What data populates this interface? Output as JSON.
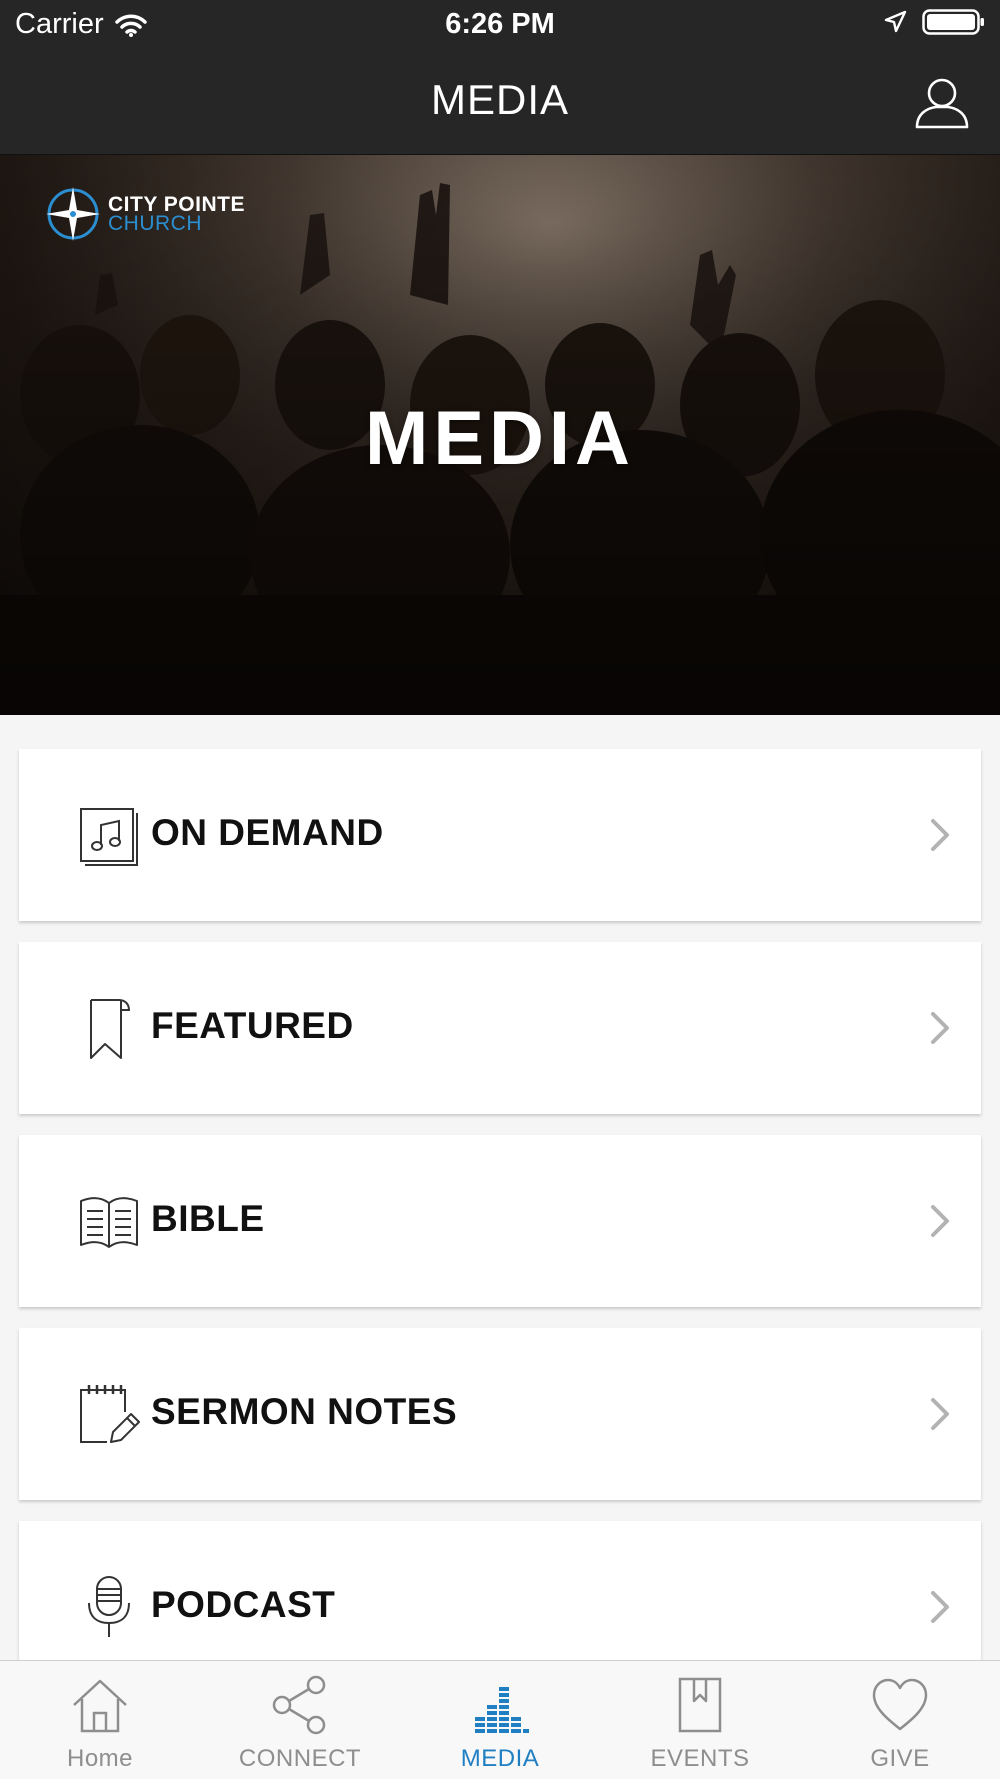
{
  "status_bar": {
    "carrier": "Carrier",
    "time": "6:26 PM"
  },
  "nav": {
    "title": "MEDIA"
  },
  "hero": {
    "logo_line1": "CITY POINTE",
    "logo_line2": "CHURCH",
    "title": "MEDIA"
  },
  "menu": {
    "items": [
      {
        "label": "ON DEMAND",
        "icon": "music-library-icon"
      },
      {
        "label": "FEATURED",
        "icon": "bookmark-icon"
      },
      {
        "label": "BIBLE",
        "icon": "open-book-icon"
      },
      {
        "label": "SERMON NOTES",
        "icon": "notepad-pencil-icon"
      },
      {
        "label": "PODCAST",
        "icon": "microphone-icon"
      }
    ]
  },
  "tabs": {
    "items": [
      {
        "label": "Home",
        "icon": "house-icon",
        "active": false
      },
      {
        "label": "CONNECT",
        "icon": "share-icon",
        "active": false
      },
      {
        "label": "MEDIA",
        "icon": "equalizer-icon",
        "active": true
      },
      {
        "label": "EVENTS",
        "icon": "bookmark-book-icon",
        "active": false
      },
      {
        "label": "GIVE",
        "icon": "heart-icon",
        "active": false
      }
    ]
  },
  "colors": {
    "bar_background": "#262626",
    "accent": "#1f7fc2",
    "logo_blue": "#2a8ed0",
    "inactive_tab": "#8e8e8e"
  }
}
